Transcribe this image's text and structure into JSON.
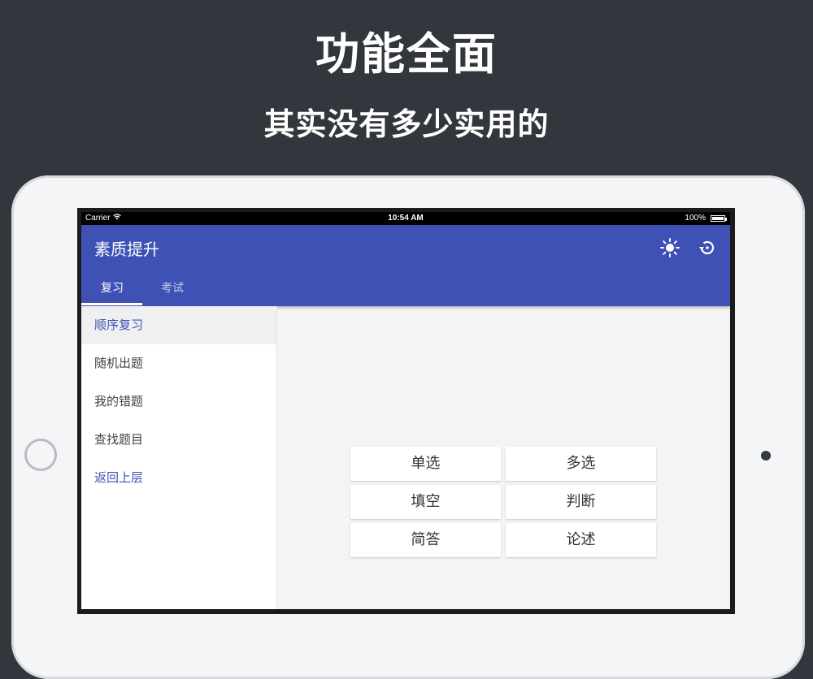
{
  "promo": {
    "headline": "功能全面",
    "subheadline": "其实没有多少实用的"
  },
  "status_bar": {
    "carrier": "Carrier",
    "wifi_icon": "wifi-icon",
    "time": "10:54 AM",
    "battery": "100%"
  },
  "app_bar": {
    "title": "素质提升",
    "background_color": "#3f51b5",
    "actions": [
      "brightness-icon",
      "history-icon"
    ],
    "tabs": [
      {
        "label": "复习",
        "active": true
      },
      {
        "label": "考试",
        "active": false
      }
    ]
  },
  "sidebar": {
    "items": [
      {
        "label": "顺序复习",
        "selected": true
      },
      {
        "label": "随机出题"
      },
      {
        "label": "我的错题"
      },
      {
        "label": "查找题目"
      },
      {
        "label": "返回上层",
        "link": true
      }
    ]
  },
  "question_types": [
    "单选",
    "多选",
    "填空",
    "判断",
    "简答",
    "论述"
  ]
}
